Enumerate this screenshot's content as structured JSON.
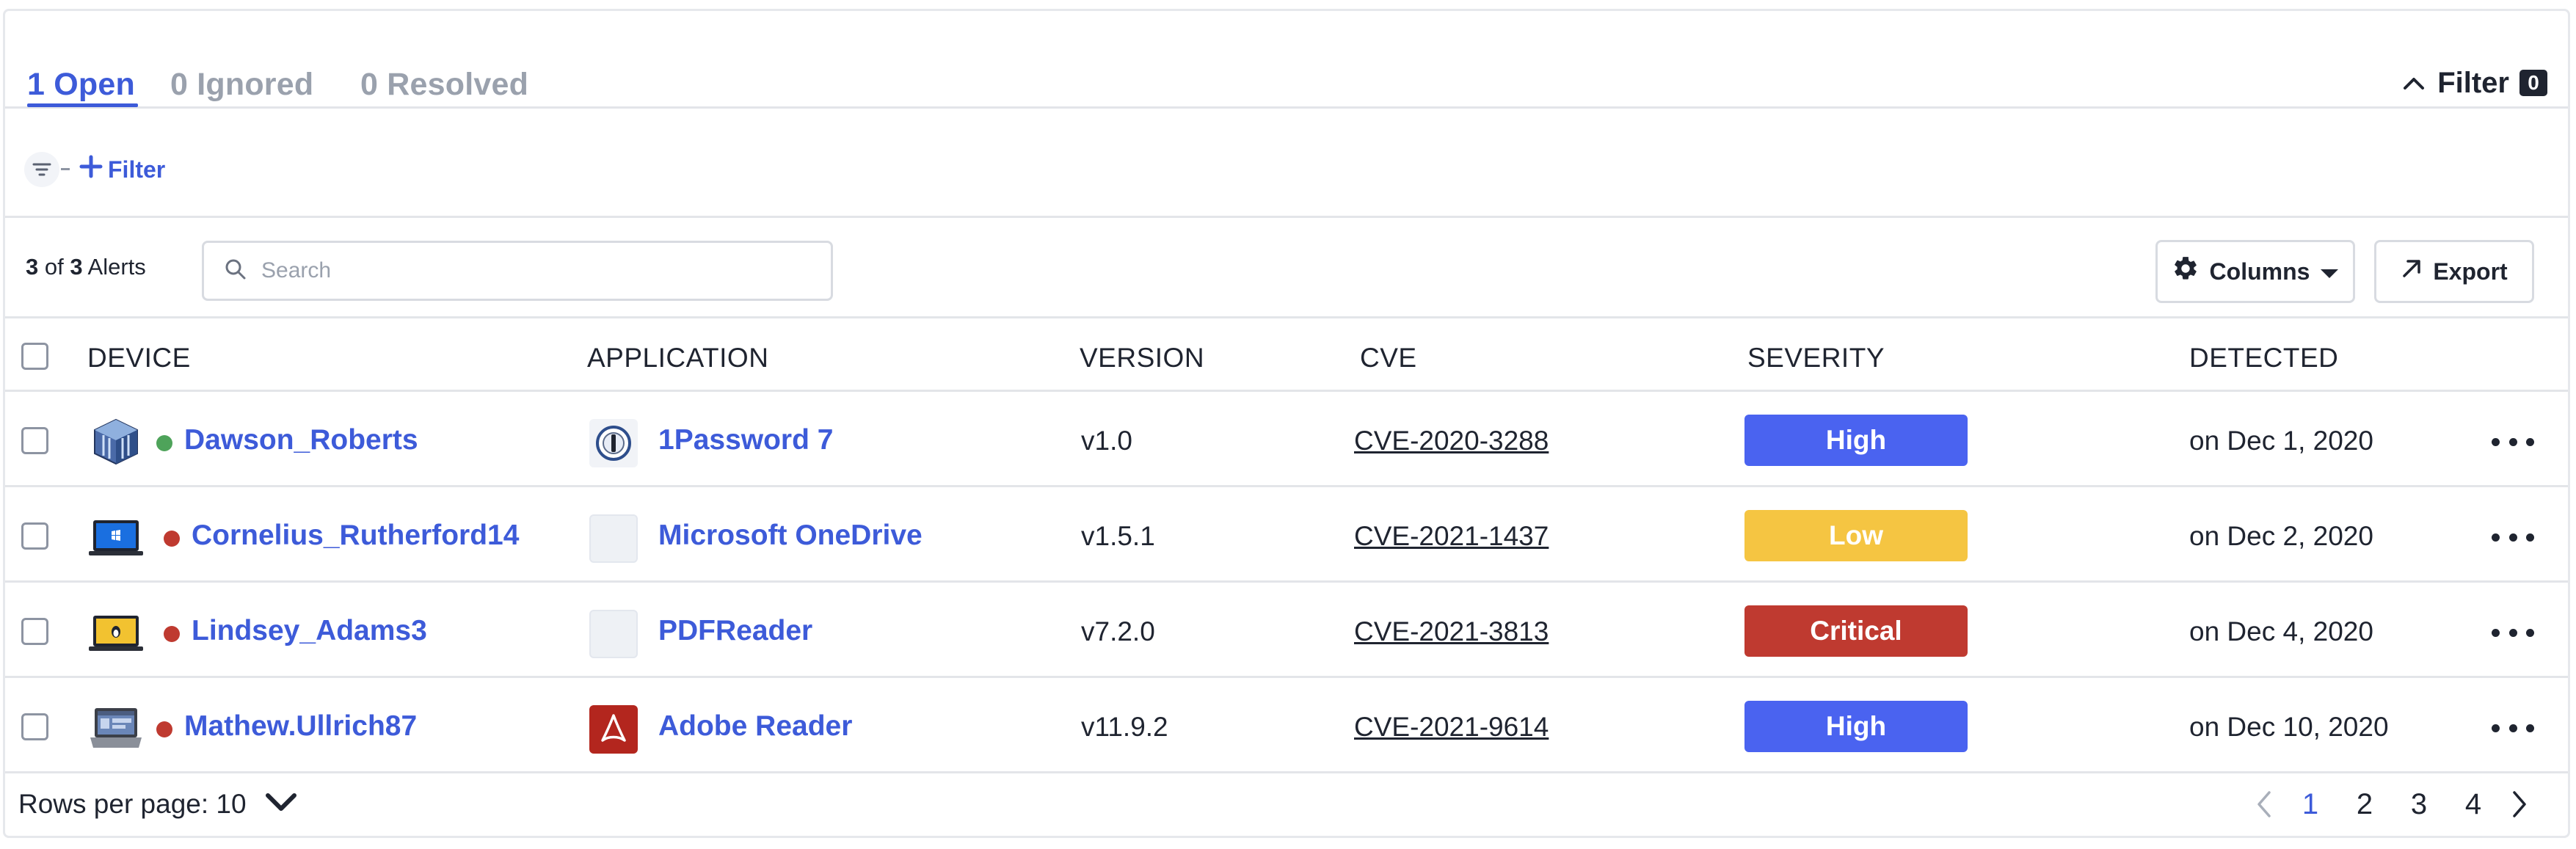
{
  "tabs": [
    {
      "label": "1 Open",
      "active": true
    },
    {
      "label": "0 Ignored",
      "active": false
    },
    {
      "label": "0 Resolved",
      "active": false
    }
  ],
  "filter_toggle": {
    "label": "Filter",
    "count": "0"
  },
  "filter_builder": {
    "add_label": "Filter"
  },
  "toolbar": {
    "count_shown": "3",
    "count_of": "of",
    "count_total": "3",
    "count_label": "Alerts",
    "search_placeholder": "Search",
    "columns_label": "Columns",
    "export_label": "Export"
  },
  "table": {
    "headers": [
      "DEVICE",
      "APPLICATION",
      "VERSION",
      "CVE",
      "SEVERITY",
      "DETECTED"
    ],
    "rows": [
      {
        "device": "Dawson_Roberts",
        "device_icon": "virtualbox-cube-icon",
        "status": "online",
        "application": "1Password 7",
        "app_icon": "1password-icon",
        "version": "v1.0",
        "cve": "CVE-2020-3288",
        "severity": "High",
        "detected": "on Dec 1, 2020"
      },
      {
        "device": "Cornelius_Rutherford14",
        "device_icon": "windows-laptop-icon",
        "status": "offline",
        "application": "Microsoft OneDrive",
        "app_icon": "placeholder-app-icon",
        "version": "v1.5.1",
        "cve": "CVE-2021-1437",
        "severity": "Low",
        "detected": "on Dec 2, 2020"
      },
      {
        "device": "Lindsey_Adams3",
        "device_icon": "linux-laptop-icon",
        "status": "offline",
        "application": "PDFReader",
        "app_icon": "placeholder-app-icon",
        "version": "v7.2.0",
        "cve": "CVE-2021-3813",
        "severity": "Critical",
        "detected": "on Dec 4, 2020"
      },
      {
        "device": "Mathew.Ullrich87",
        "device_icon": "macbook-icon",
        "status": "offline",
        "application": "Adobe Reader",
        "app_icon": "adobe-reader-icon",
        "version": "v11.9.2",
        "cve": "CVE-2021-9614",
        "severity": "High",
        "detected": "on Dec 10, 2020"
      }
    ]
  },
  "footer": {
    "rows_per_page_label": "Rows per page: 10",
    "pages": [
      "1",
      "2",
      "3",
      "4"
    ],
    "current_page": "1"
  },
  "colors": {
    "accent": "#3d5bd9",
    "severity_high": "#4a63f0",
    "severity_low": "#f5c542",
    "severity_critical": "#bf3a30",
    "status_online": "#4ea35a",
    "status_offline": "#bf3a30"
  }
}
